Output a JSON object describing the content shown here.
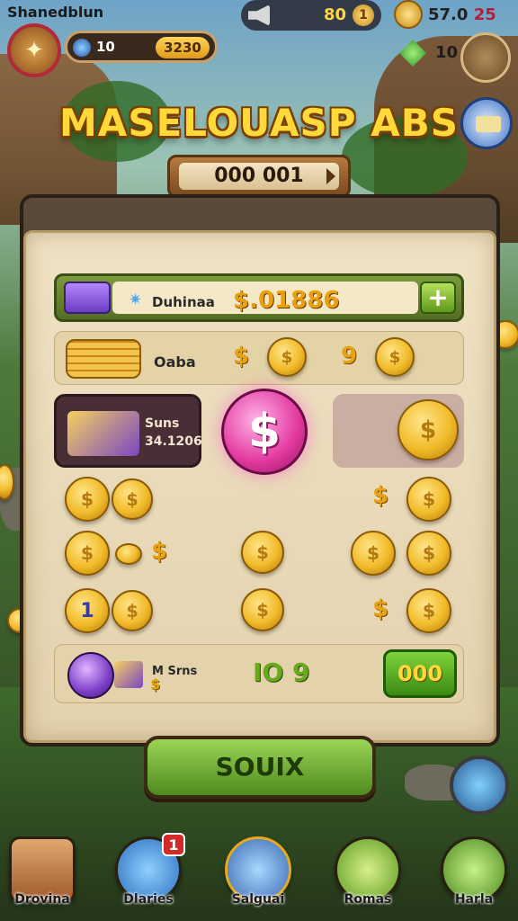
{
  "app_name": "Shanedblun",
  "top": {
    "player_level": "10",
    "player_gold": "3230",
    "speaker_count": "80",
    "speaker_coin_value": "1",
    "score": "57.0",
    "score_extra": "25",
    "leaf_count": "10"
  },
  "title": "MASELOUASP ABS",
  "sign": {
    "value": "000 001"
  },
  "balance": {
    "label": "Duhinaa",
    "value": "$.01886",
    "add_label": "+"
  },
  "tier": {
    "label": "Oaba",
    "d1": "$",
    "d2": "9"
  },
  "featured": {
    "name": "Suns",
    "price": "34.1206"
  },
  "coin_row_1": {
    "d1": "$"
  },
  "coin_row_2": {
    "d1": "$"
  },
  "coin_row_3": {
    "d1": "1",
    "d2": "$"
  },
  "bundle": {
    "name": "M Srns",
    "mark": "$",
    "price": "IO 9",
    "buy_label": "000"
  },
  "main_button": {
    "label": "SOUIX"
  },
  "nav": [
    {
      "label": "Drovina",
      "icon": "gift-icon"
    },
    {
      "label": "Dlaries",
      "icon": "pet-icon",
      "badge": "1"
    },
    {
      "label": "Salguai",
      "icon": "potion-icon"
    },
    {
      "label": "Romas",
      "icon": "basket-icon"
    },
    {
      "label": "Harla",
      "icon": "carrot-icon"
    }
  ],
  "colors": {
    "accent_gold": "#ffd93a",
    "button_green": "#5fa82a",
    "featured_pink": "#e2369e"
  }
}
